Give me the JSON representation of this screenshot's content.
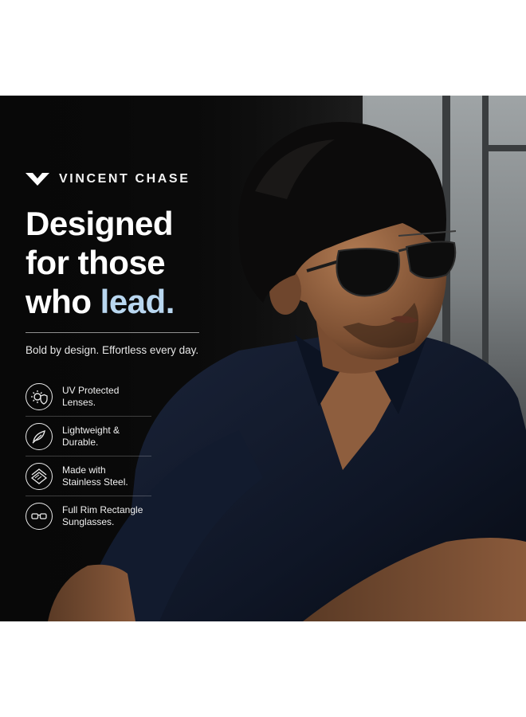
{
  "brand": {
    "name": "VINCENT CHASE"
  },
  "headline": {
    "line1": "Designed",
    "line2": "for those",
    "line3_prefix": "who ",
    "line3_accent": "lead."
  },
  "tagline": "Bold by design. Effortless every day.",
  "features": [
    {
      "icon": "uv-shield-icon",
      "line1": "UV Protected",
      "line2": "Lenses."
    },
    {
      "icon": "feather-icon",
      "line1": "Lightweight &",
      "line2": "Durable."
    },
    {
      "icon": "steel-layers-icon",
      "line1": "Made with",
      "line2": "Stainless Steel."
    },
    {
      "icon": "glasses-icon",
      "line1": "Full Rim Rectangle",
      "line2": "Sunglasses."
    }
  ],
  "colors": {
    "background": "#ffffff",
    "panel": "#0b0b0b",
    "accent": "#b9d7f0",
    "text": "#ffffff",
    "shirt": "#111a2e"
  }
}
